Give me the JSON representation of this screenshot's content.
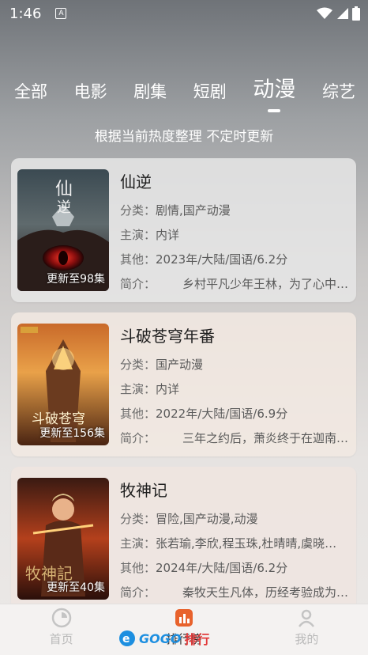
{
  "status_bar": {
    "time": "1:46",
    "badge": "A"
  },
  "tabs": [
    {
      "label": "全部"
    },
    {
      "label": "电影"
    },
    {
      "label": "剧集"
    },
    {
      "label": "短剧"
    },
    {
      "label": "动漫",
      "active": true
    },
    {
      "label": "综艺"
    }
  ],
  "subtitle": "根据当前热度整理 不定时更新",
  "labels": {
    "category": "分类：",
    "cast": "主演：",
    "other": "其他：",
    "intro": "简介："
  },
  "items": [
    {
      "title": "仙逆",
      "badge": "更新至98集",
      "category": "剧情,国产动漫",
      "cast": "内详",
      "other": "2023年/大陆/国语/6.2分",
      "intro": "乡村平凡少年王林，为了心中…"
    },
    {
      "title": "斗破苍穹年番",
      "badge": "更新至156集",
      "category": "国产动漫",
      "cast": "内详",
      "other": "2022年/大陆/国语/6.9分",
      "intro": "三年之约后，萧炎终于在迦南…"
    },
    {
      "title": "牧神记",
      "badge": "更新至40集",
      "category": "冒险,国产动漫,动漫",
      "cast": "张若瑜,李欣,程玉珠,杜晴晴,虞晓…",
      "other": "2024年/大陆/国语/6.2分",
      "intro": "秦牧天生凡体，历经考验成为…"
    }
  ],
  "bottom_nav": [
    {
      "label": "首页",
      "icon": "home-icon"
    },
    {
      "label": "排行榜",
      "icon": "chart-icon",
      "active": true
    },
    {
      "label": "我的",
      "icon": "profile-icon"
    }
  ],
  "watermark": {
    "brand": "GOGO",
    "suffix": "排行"
  },
  "colors": {
    "accent": "#e8622c",
    "watermark_blue": "#1d8fe0"
  }
}
